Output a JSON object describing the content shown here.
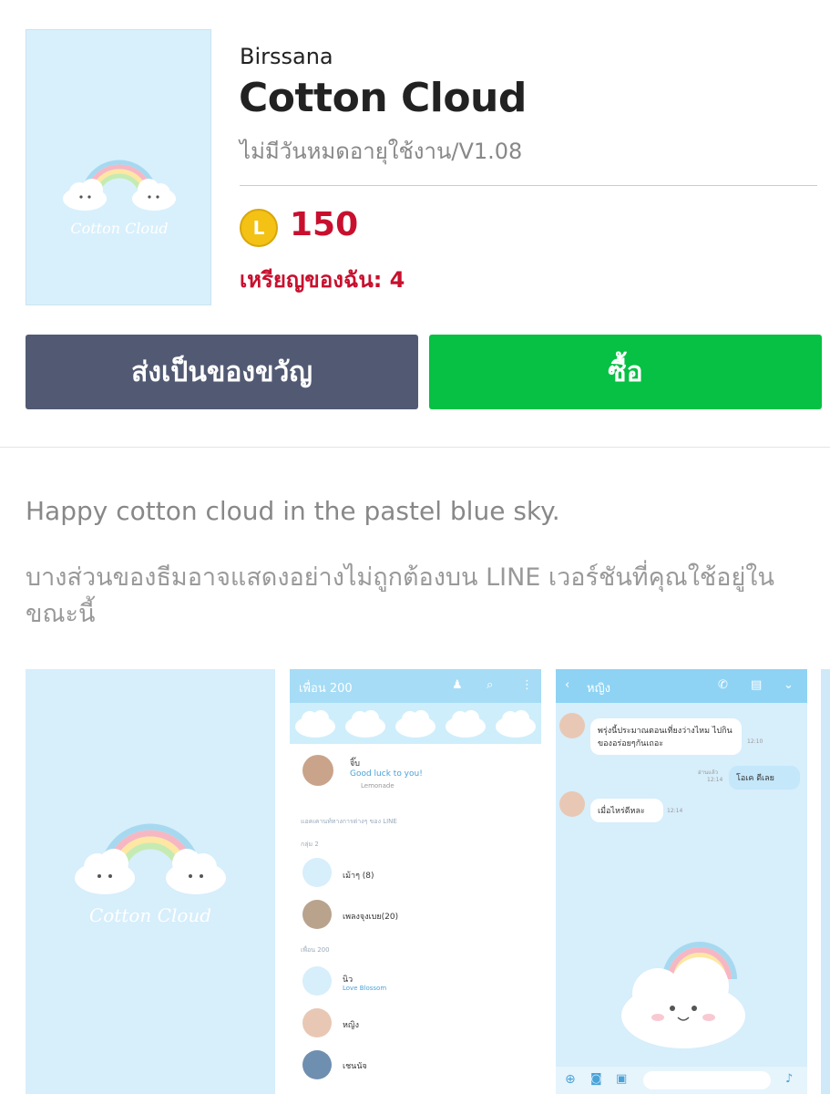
{
  "theme": {
    "author": "Birssana",
    "title": "Cotton Cloud",
    "validity": "ไม่มีวันหมดอายุใช้งาน/V1.08",
    "thumbnail_text": "Cotton Cloud"
  },
  "price": {
    "coin_symbol": "L",
    "amount": "150",
    "my_coins": "เหรียญของฉัน: 4"
  },
  "buttons": {
    "gift": "ส่งเป็นของขวัญ",
    "buy": "ซื้อ"
  },
  "description": {
    "text": "Happy cotton cloud in the pastel blue sky.",
    "note": "บางส่วนของธีมอาจแสดงอย่างไม่ถูกต้องบน LINE เวอร์ชันที่คุณใช้อยู่ในขณะนี้"
  },
  "preview": {
    "friends": {
      "header": "เพื่อน 200",
      "me_name": "จิ๊บ",
      "me_status": "Good luck to you!",
      "me_music": "Lemonade",
      "section1": "แอคเคานท์ทางการต่างๆ ของ LINE",
      "section2": "กลุ่ม 2",
      "group1": "เม้าๆ (8)",
      "group2": "เพลงจุงเบย(20)",
      "section3": "เพื่อน 200",
      "friend1": "นิว",
      "friend1_status": "Love Blossom",
      "friend2": "หญิง",
      "friend3": "เชนนัจ"
    },
    "chat": {
      "header": "หญิง",
      "msg1": "พรุ่งนี้ประมาณตอนเที่ยงว่างไหม ไปกินของอร่อยๆกันเถอะ",
      "time1": "12:10",
      "msg2": "โอเค ดีเลย",
      "read2": "อ่านแล้ว",
      "time2": "12:14",
      "msg3": "เมื่อไหร่ดีหละ",
      "time3": "12:14"
    }
  },
  "colors": {
    "accent_green": "#06c143",
    "gift_gray": "#525a73",
    "price_red": "#c8102e",
    "sky": "#d7eefb"
  }
}
